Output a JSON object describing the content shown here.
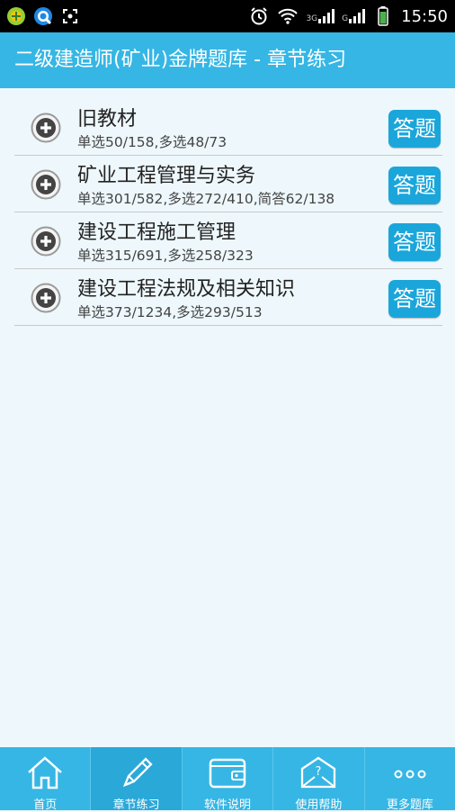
{
  "status_bar": {
    "time": "15:50",
    "net1": "3G",
    "net2": "G"
  },
  "header": {
    "title": "二级建造师(矿业)金牌题库  -  章节练习"
  },
  "chapters": [
    {
      "title": "旧教材",
      "stats": "单选50/158,多选48/73",
      "button": "答题"
    },
    {
      "title": "矿业工程管理与实务",
      "stats": "单选301/582,多选272/410,简答62/138",
      "button": "答题"
    },
    {
      "title": "建设工程施工管理",
      "stats": "单选315/691,多选258/323",
      "button": "答题"
    },
    {
      "title": "建设工程法规及相关知识",
      "stats": "单选373/1234,多选293/513",
      "button": "答题"
    }
  ],
  "bottom_nav": [
    {
      "label": "首页",
      "icon": "home-icon"
    },
    {
      "label": "章节练习",
      "icon": "pencil-icon"
    },
    {
      "label": "软件说明",
      "icon": "wallet-icon"
    },
    {
      "label": "使用帮助",
      "icon": "help-mail-icon"
    },
    {
      "label": "更多题库",
      "icon": "more-icon"
    }
  ]
}
